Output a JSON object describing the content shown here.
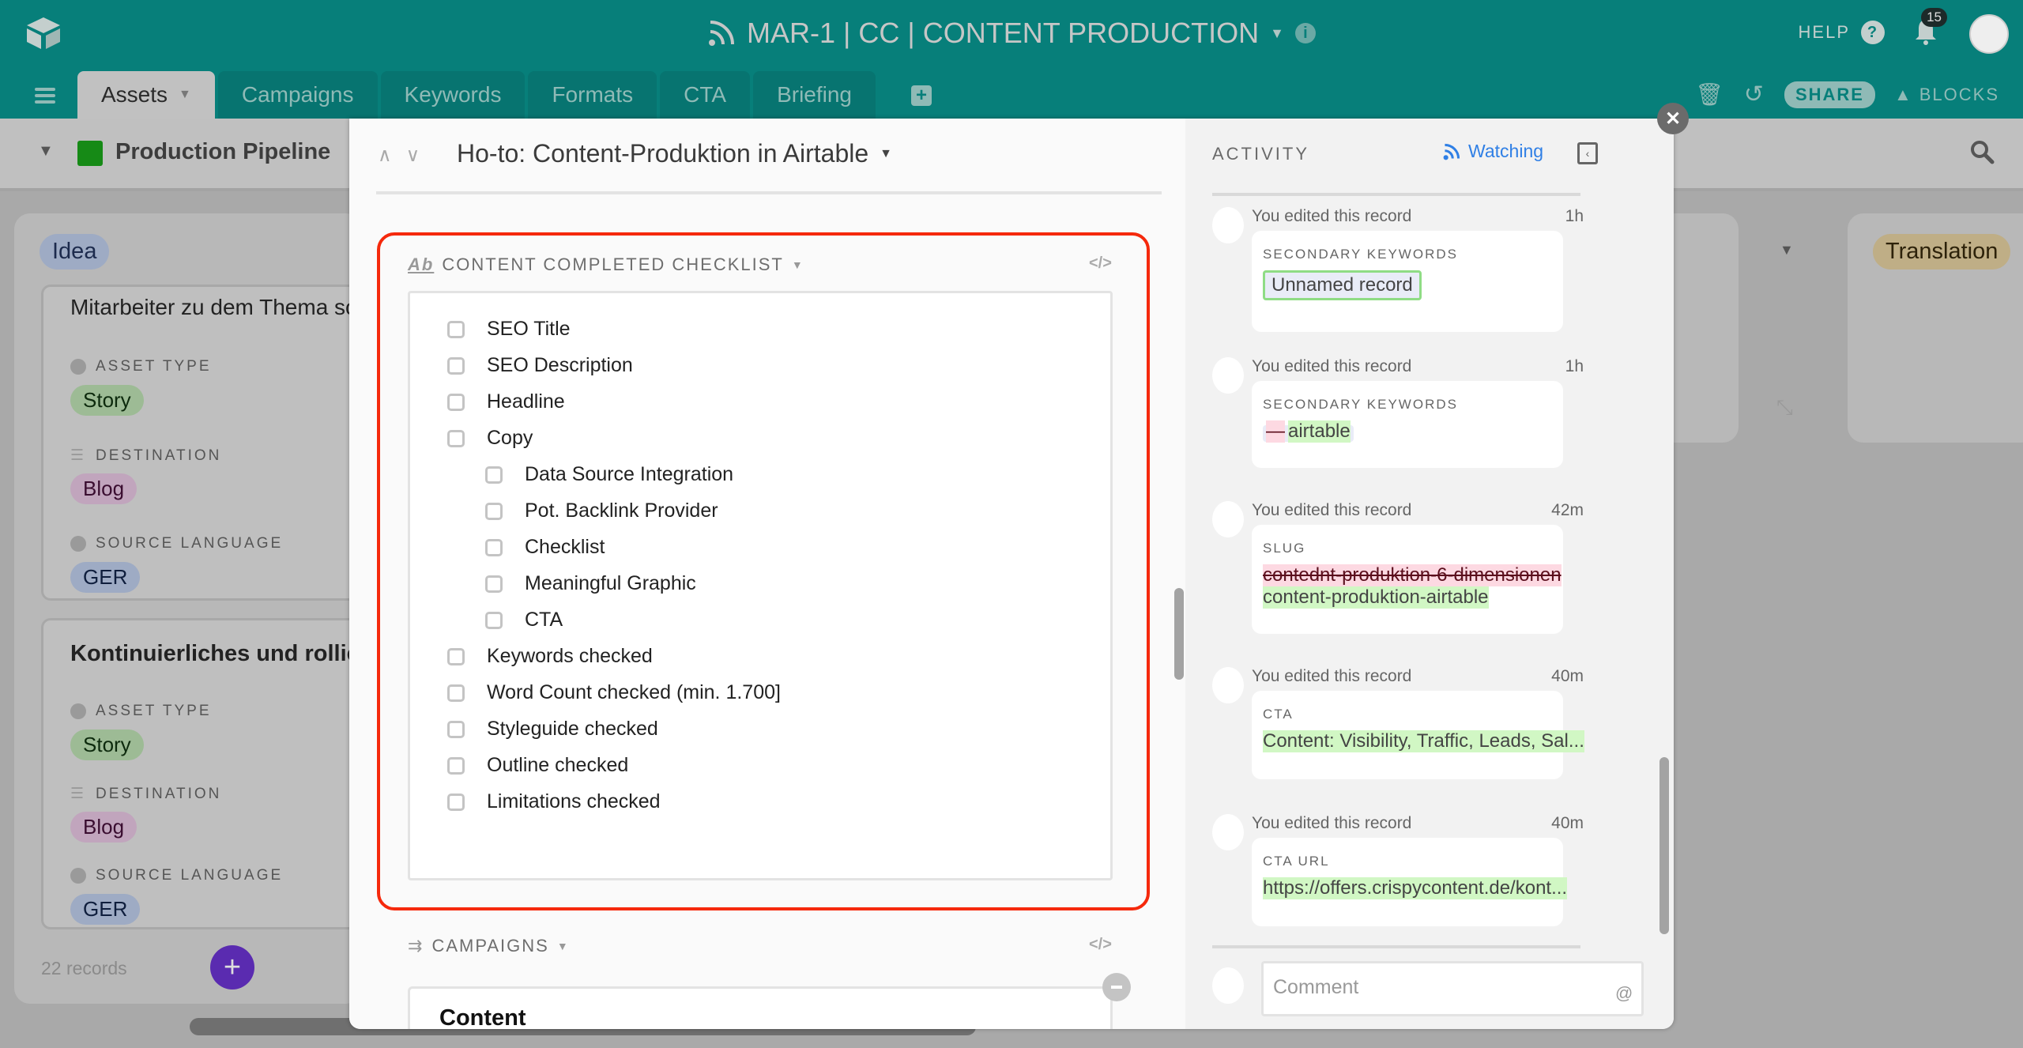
{
  "topbar": {
    "base_title": "MAR-1 | CC | CONTENT PRODUCTION",
    "help_label": "HELP",
    "notification_count": "15",
    "share_label": "SHARE",
    "blocks_label": "BLOCKS"
  },
  "tabs": [
    {
      "label": "Assets",
      "active": true
    },
    {
      "label": "Campaigns"
    },
    {
      "label": "Keywords"
    },
    {
      "label": "Formats"
    },
    {
      "label": "CTA"
    },
    {
      "label": "Briefing"
    }
  ],
  "view": {
    "name": "Production Pipeline"
  },
  "kanban": {
    "columns": [
      {
        "name": "Idea",
        "color": "#9eabc4"
      },
      {
        "name": "Translation",
        "color": "#bfae86"
      }
    ],
    "cards": [
      {
        "title": "Mitarbeiter zu dem Thema schu",
        "fields": [
          {
            "label": "ASSET TYPE",
            "value": "Story"
          },
          {
            "label": "DESTINATION",
            "value": "Blog"
          },
          {
            "label": "SOURCE LANGUAGE",
            "value": "GER"
          }
        ]
      },
      {
        "title": "Kontinuierliches und rollie",
        "fields": [
          {
            "label": "ASSET TYPE",
            "value": "Story"
          },
          {
            "label": "DESTINATION",
            "value": "Blog"
          },
          {
            "label": "SOURCE LANGUAGE",
            "value": "GER"
          }
        ]
      }
    ],
    "record_count": "22 records"
  },
  "record": {
    "title": "Ho-to: Content-Produktion in Airtable",
    "checklist_label": "CONTENT COMPLETED CHECKLIST",
    "checklist": [
      {
        "label": "SEO Title",
        "level": 0,
        "checked": false
      },
      {
        "label": "SEO Description",
        "level": 0,
        "checked": false
      },
      {
        "label": "Headline",
        "level": 0,
        "checked": false
      },
      {
        "label": "Copy",
        "level": 0,
        "checked": false
      },
      {
        "label": "Data Source Integration",
        "level": 1,
        "checked": false
      },
      {
        "label": "Pot. Backlink Provider",
        "level": 1,
        "checked": false
      },
      {
        "label": "Checklist",
        "level": 1,
        "checked": false
      },
      {
        "label": "Meaningful Graphic",
        "level": 1,
        "checked": false
      },
      {
        "label": "CTA",
        "level": 1,
        "checked": false
      },
      {
        "label": "Keywords checked",
        "level": 0,
        "checked": false
      },
      {
        "label": "Word Count checked (min. 1.700]",
        "level": 0,
        "checked": false
      },
      {
        "label": "Styleguide checked",
        "level": 0,
        "checked": false
      },
      {
        "label": "Outline checked",
        "level": 0,
        "checked": false
      },
      {
        "label": "Limitations checked",
        "level": 0,
        "checked": false
      }
    ],
    "campaigns_label": "CAMPAIGNS",
    "campaign_value": "Content"
  },
  "activity": {
    "title": "ACTIVITY",
    "watching_label": "Watching",
    "entries": [
      {
        "text": "You edited this record",
        "time": "1h",
        "field": "SECONDARY KEYWORDS",
        "added": "Unnamed record"
      },
      {
        "text": "You edited this record",
        "time": "1h",
        "field": "SECONDARY KEYWORDS",
        "removed": "—",
        "added": "airtable"
      },
      {
        "text": "You edited this record",
        "time": "42m",
        "field": "SLUG",
        "removed": "contednt-produktion-6-dimensionen",
        "added": "content-produktion-airtable"
      },
      {
        "text": "You edited this record",
        "time": "40m",
        "field": "CTA",
        "added": "Content: Visibility, Traffic, Leads, Sal..."
      },
      {
        "text": "You edited this record",
        "time": "40m",
        "field": "CTA URL",
        "added": "https://offers.crispycontent.de/kont..."
      }
    ],
    "comment_placeholder": "Comment",
    "mention_symbol": "@"
  },
  "colors": {
    "brand_teal": "#077f7a",
    "highlight_red": "#f5290c",
    "watching_blue": "#2f7fe5",
    "added_green": "#d1f7c4",
    "removed_pink": "#fdd9e2"
  }
}
